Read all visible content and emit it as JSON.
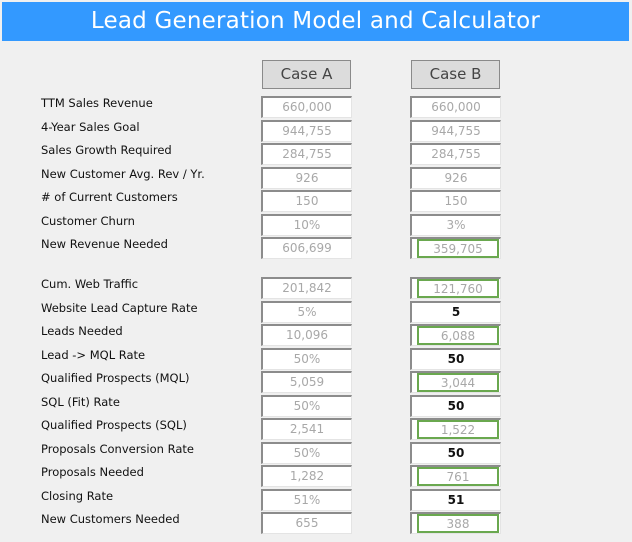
{
  "title": "Lead Generation Model and Calculator",
  "cases": [
    {
      "label": "Case A"
    },
    {
      "label": "Case B"
    }
  ],
  "colors": {
    "header_bg": "#3399ff",
    "highlight_border": "#6aa84f",
    "background": "#f0f0f0"
  },
  "section1": [
    {
      "label": "TTM Sales Revenue",
      "a": "660,000",
      "b": "660,000",
      "b_type": "computed"
    },
    {
      "label": "4-Year Sales Goal",
      "a": "944,755",
      "b": "944,755",
      "b_type": "computed"
    },
    {
      "label": "Sales Growth Required",
      "a": "284,755",
      "b": "284,755",
      "b_type": "computed"
    },
    {
      "label": "New Customer Avg. Rev / Yr.",
      "a": "926",
      "b": "926",
      "b_type": "computed"
    },
    {
      "label": "# of Current Customers",
      "a": "150",
      "b": "150",
      "b_type": "computed"
    },
    {
      "label": "Customer Churn",
      "a": "10%",
      "b": "3%",
      "b_type": "computed"
    },
    {
      "label": "New Revenue Needed",
      "a": "606,699",
      "b": "359,705",
      "b_type": "highlight"
    }
  ],
  "section2": [
    {
      "label": "Cum. Web Traffic",
      "a": "201,842",
      "b": "121,760",
      "b_type": "highlight"
    },
    {
      "label": "Website Lead Capture Rate",
      "a": "5%",
      "b": "5",
      "b_type": "input"
    },
    {
      "label": "Leads Needed",
      "a": "10,096",
      "b": "6,088",
      "b_type": "highlight"
    },
    {
      "label": "Lead -> MQL Rate",
      "a": "50%",
      "b": "50",
      "b_type": "input"
    },
    {
      "label": "Qualified Prospects (MQL)",
      "a": "5,059",
      "b": "3,044",
      "b_type": "highlight"
    },
    {
      "label": "SQL (Fit) Rate",
      "a": "50%",
      "b": "50",
      "b_type": "input"
    },
    {
      "label": "Qualified Prospects (SQL)",
      "a": "2,541",
      "b": "1,522",
      "b_type": "highlight"
    },
    {
      "label": "Proposals Conversion Rate",
      "a": "50%",
      "b": "50",
      "b_type": "input"
    },
    {
      "label": "Proposals Needed",
      "a": "1,282",
      "b": "761",
      "b_type": "highlight"
    },
    {
      "label": "Closing Rate",
      "a": "51%",
      "b": "51",
      "b_type": "input"
    },
    {
      "label": "New Customers Needed",
      "a": "655",
      "b": "388",
      "b_type": "highlight"
    }
  ]
}
